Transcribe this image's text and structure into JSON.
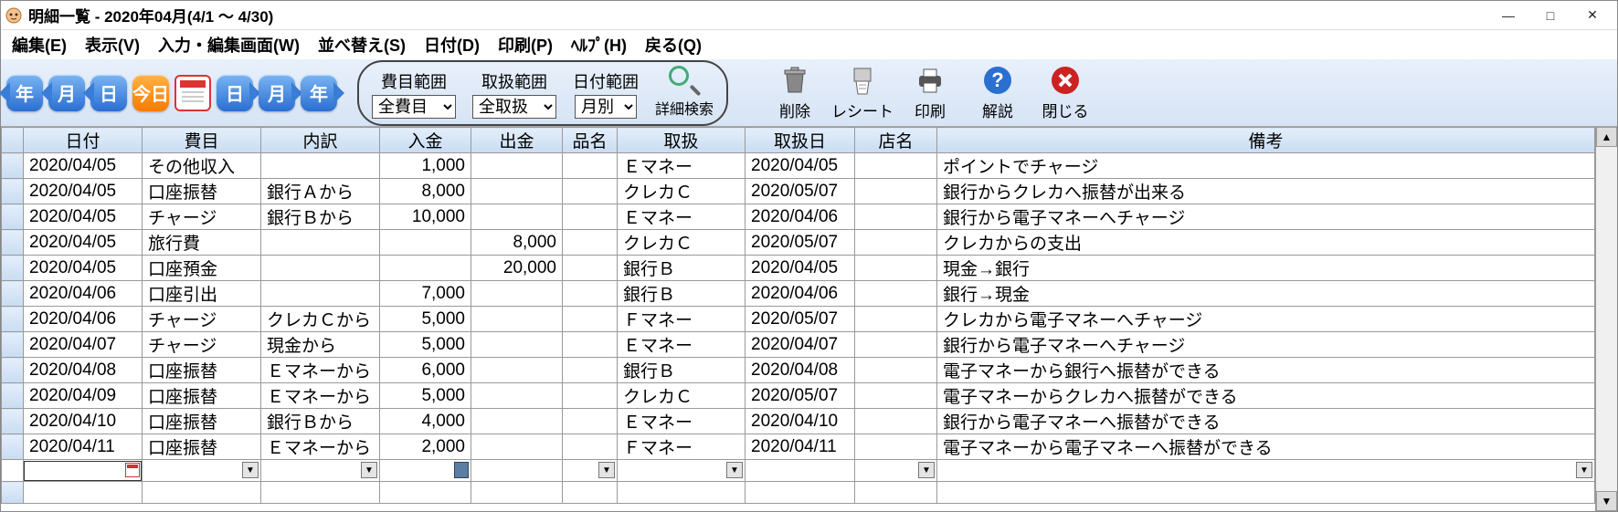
{
  "title": "明細一覧 - 2020年04月(4/1 ～ 4/30)",
  "menu": {
    "edit": "編集(E)",
    "view": "表示(V)",
    "input": "入力・編集画面(W)",
    "sort": "並べ替え(S)",
    "date": "日付(D)",
    "print": "印刷(P)",
    "help": "ﾍﾙﾌﾟ(H)",
    "back": "戻る(Q)"
  },
  "nav": {
    "year_prev": "年",
    "month_prev": "月",
    "day_prev": "日",
    "today": "今日",
    "day_next": "日",
    "month_next": "月",
    "year_next": "年"
  },
  "filters": {
    "category_label": "費目範囲",
    "category_value": "全費目",
    "handle_label": "取扱範囲",
    "handle_value": "全取扱",
    "date_label": "日付範囲",
    "date_value": "月別",
    "search_label": "詳細検索"
  },
  "tools": {
    "delete": "削除",
    "receipt": "レシート",
    "print": "印刷",
    "help": "解説",
    "close": "閉じる"
  },
  "headers": {
    "date": "日付",
    "category": "費目",
    "detail": "内訳",
    "in": "入金",
    "out": "出金",
    "item": "品名",
    "handle": "取扱",
    "hdate": "取扱日",
    "shop": "店名",
    "note": "備考"
  },
  "rows": [
    {
      "date": "2020/04/05",
      "category": "その他収入",
      "detail": "",
      "in": "1,000",
      "out": "",
      "item": "",
      "handle": "Ｅマネー",
      "hdate": "2020/04/05",
      "shop": "",
      "note": "ポイントでチャージ"
    },
    {
      "date": "2020/04/05",
      "category": "口座振替",
      "detail": "銀行Ａから",
      "in": "8,000",
      "out": "",
      "item": "",
      "handle": "クレカＣ",
      "hdate": "2020/05/07",
      "shop": "",
      "note": "銀行からクレカへ振替が出来る"
    },
    {
      "date": "2020/04/05",
      "category": "チャージ",
      "detail": "銀行Ｂから",
      "in": "10,000",
      "out": "",
      "item": "",
      "handle": "Ｅマネー",
      "hdate": "2020/04/06",
      "shop": "",
      "note": "銀行から電子マネーへチャージ"
    },
    {
      "date": "2020/04/05",
      "category": "旅行費",
      "detail": "",
      "in": "",
      "out": "8,000",
      "item": "",
      "handle": "クレカＣ",
      "hdate": "2020/05/07",
      "shop": "",
      "note": "クレカからの支出"
    },
    {
      "date": "2020/04/05",
      "category": "口座預金",
      "detail": "",
      "in": "",
      "out": "20,000",
      "item": "",
      "handle": "銀行Ｂ",
      "hdate": "2020/04/05",
      "shop": "",
      "note": "現金→銀行"
    },
    {
      "date": "2020/04/06",
      "category": "口座引出",
      "detail": "",
      "in": "7,000",
      "out": "",
      "item": "",
      "handle": "銀行Ｂ",
      "hdate": "2020/04/06",
      "shop": "",
      "note": "銀行→現金"
    },
    {
      "date": "2020/04/06",
      "category": "チャージ",
      "detail": "クレカＣから",
      "in": "5,000",
      "out": "",
      "item": "",
      "handle": "Ｆマネー",
      "hdate": "2020/05/07",
      "shop": "",
      "note": "クレカから電子マネーへチャージ"
    },
    {
      "date": "2020/04/07",
      "category": "チャージ",
      "detail": "現金から",
      "in": "5,000",
      "out": "",
      "item": "",
      "handle": "Ｅマネー",
      "hdate": "2020/04/07",
      "shop": "",
      "note": "銀行から電子マネーへチャージ"
    },
    {
      "date": "2020/04/08",
      "category": "口座振替",
      "detail": "Ｅマネーから",
      "in": "6,000",
      "out": "",
      "item": "",
      "handle": "銀行Ｂ",
      "hdate": "2020/04/08",
      "shop": "",
      "note": "電子マネーから銀行へ振替ができる"
    },
    {
      "date": "2020/04/09",
      "category": "口座振替",
      "detail": "Ｅマネーから",
      "in": "5,000",
      "out": "",
      "item": "",
      "handle": "クレカＣ",
      "hdate": "2020/05/07",
      "shop": "",
      "note": "電子マネーからクレカへ振替ができる"
    },
    {
      "date": "2020/04/10",
      "category": "口座振替",
      "detail": "銀行Ｂから",
      "in": "4,000",
      "out": "",
      "item": "",
      "handle": "Ｅマネー",
      "hdate": "2020/04/10",
      "shop": "",
      "note": "銀行から電子マネーへ振替ができる"
    },
    {
      "date": "2020/04/11",
      "category": "口座振替",
      "detail": "Ｅマネーから",
      "in": "2,000",
      "out": "",
      "item": "",
      "handle": "Ｆマネー",
      "hdate": "2020/04/11",
      "shop": "",
      "note": "電子マネーから電子マネーへ振替ができる"
    }
  ]
}
